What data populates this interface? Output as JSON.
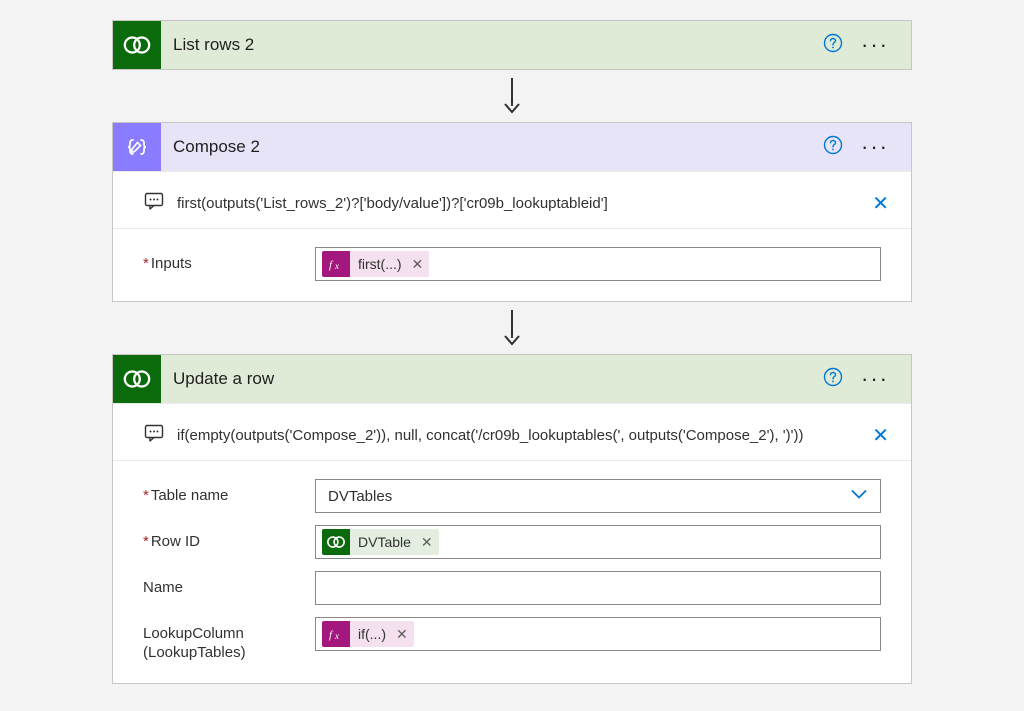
{
  "steps": {
    "listRows": {
      "title": "List rows 2"
    },
    "compose": {
      "title": "Compose 2",
      "comment": "first(outputs('List_rows_2')?['body/value'])?['cr09b_lookuptableid']",
      "fields": {
        "inputs": {
          "label": "Inputs",
          "pill": "first(...)"
        }
      }
    },
    "updateRow": {
      "title": "Update a row",
      "comment": "if(empty(outputs('Compose_2')), null, concat('/cr09b_lookuptables(', outputs('Compose_2'), ')'))",
      "fields": {
        "tableName": {
          "label": "Table name",
          "value": "DVTables"
        },
        "rowId": {
          "label": "Row ID",
          "pill": "DVTable"
        },
        "name": {
          "label": "Name"
        },
        "lookup": {
          "label": "LookupColumn (LookupTables)",
          "pill": "if(...)"
        }
      }
    }
  }
}
